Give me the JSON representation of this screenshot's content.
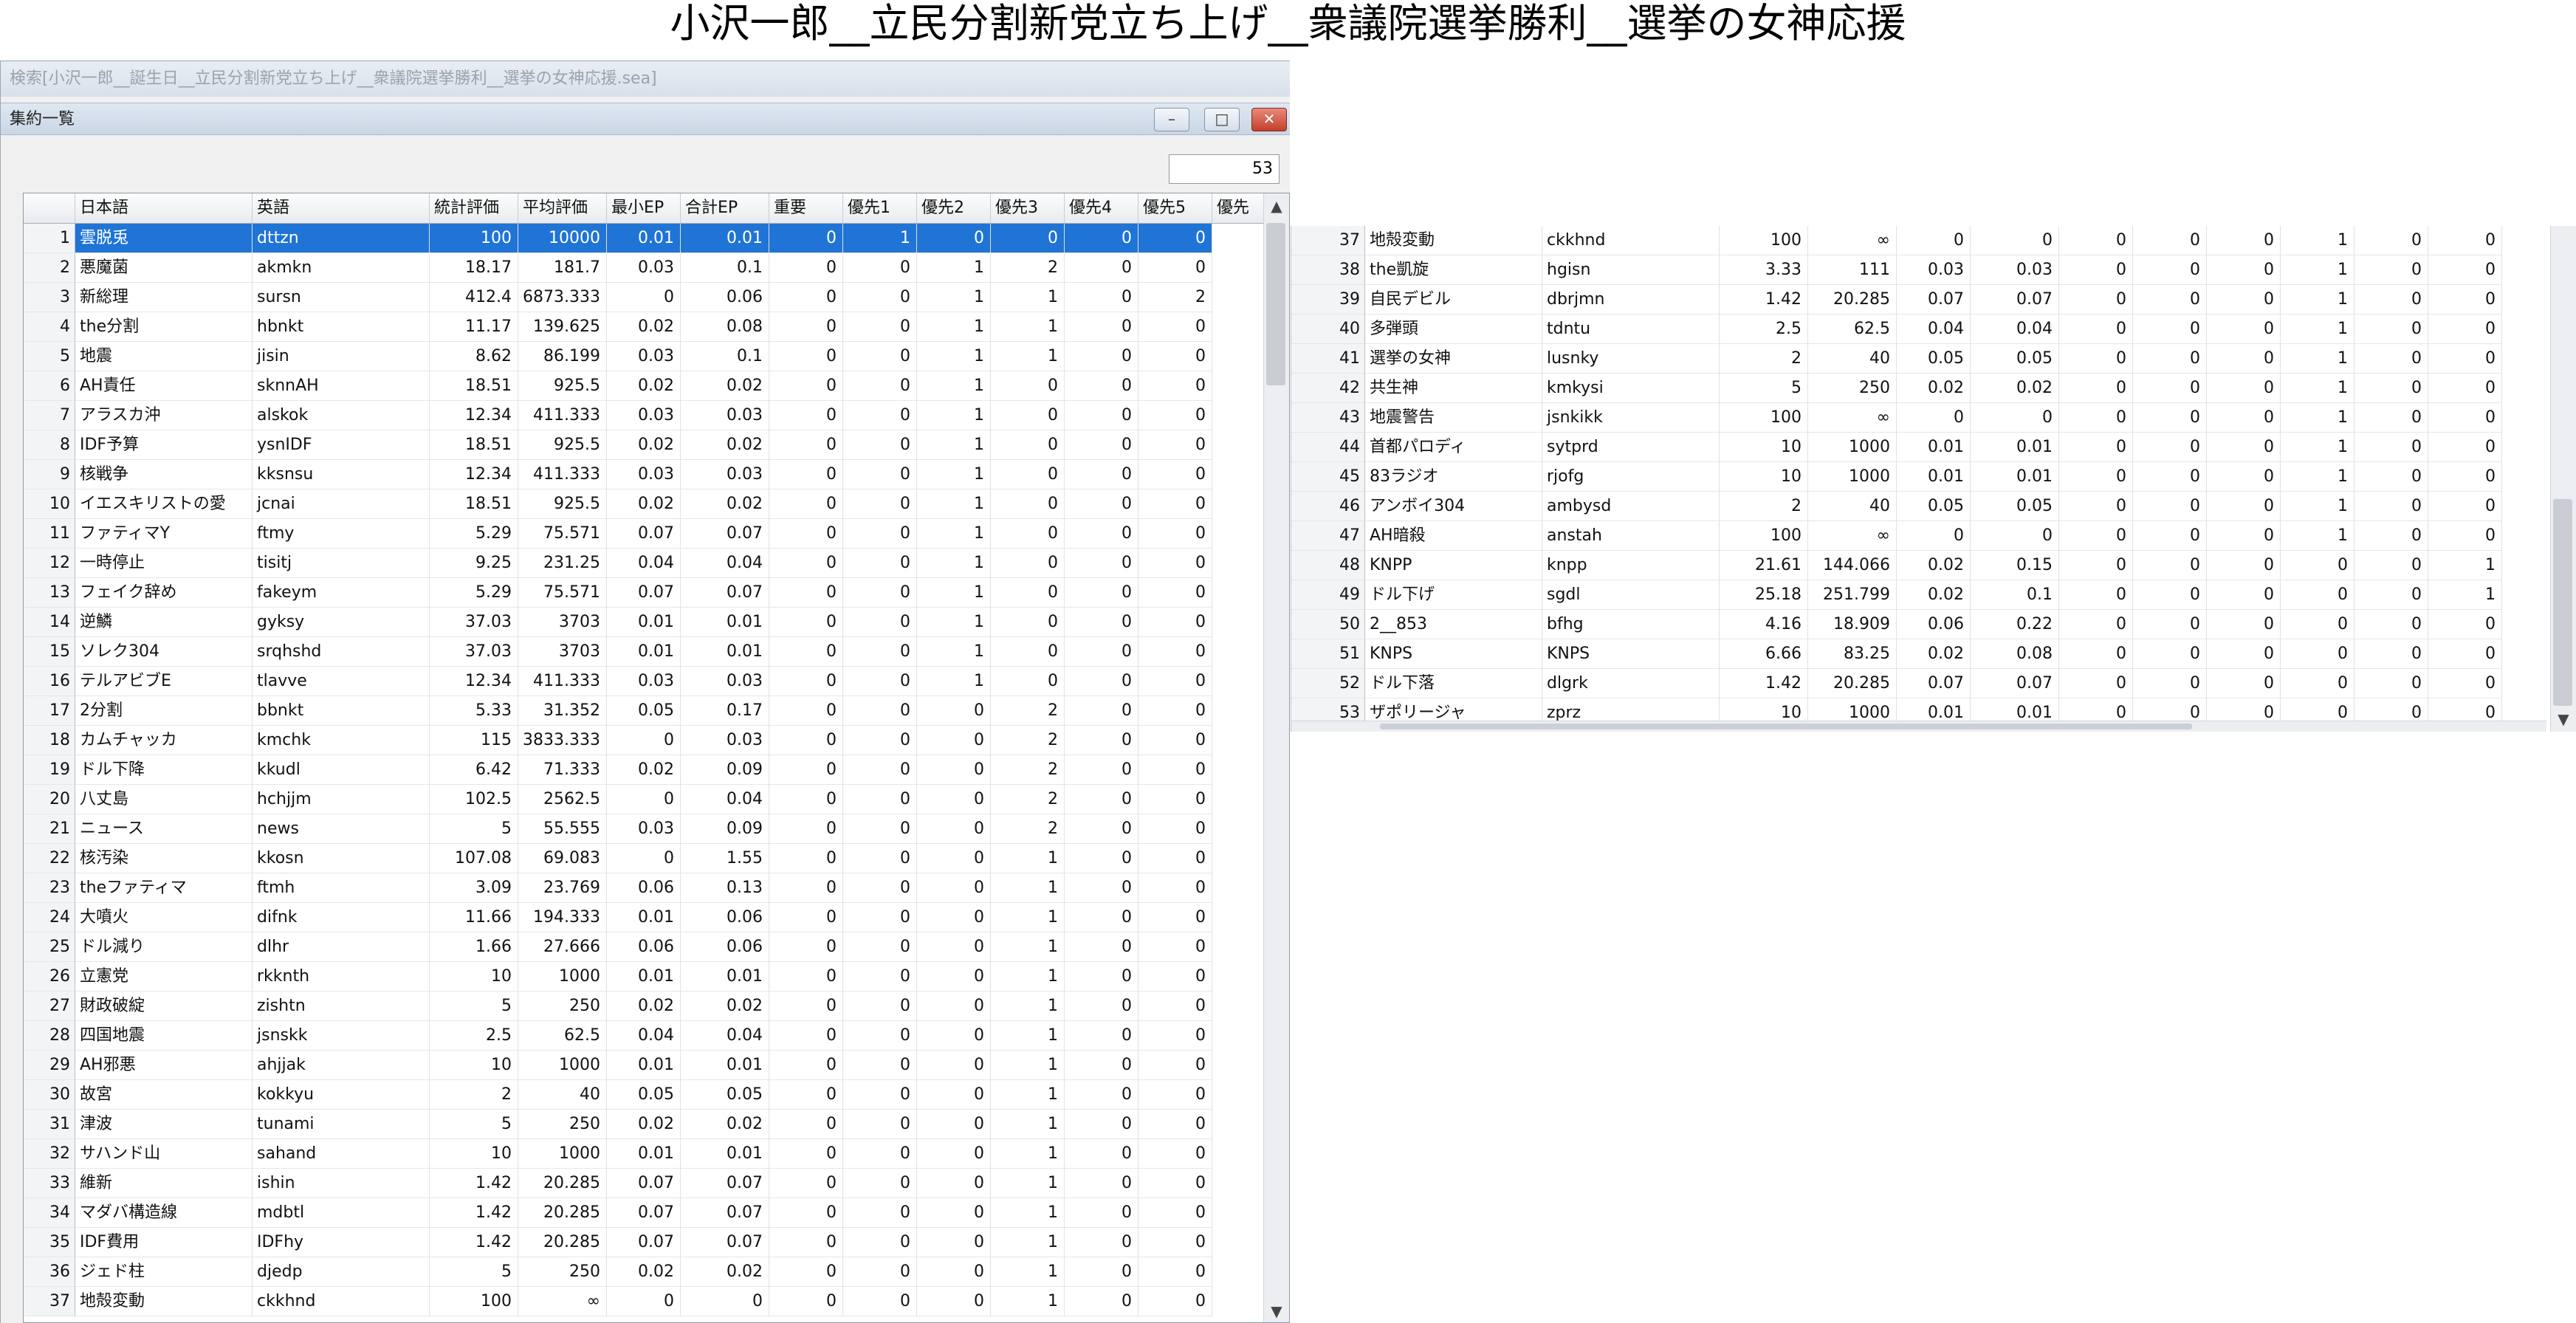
{
  "page_title": "小沢一郎__立民分割新党立ち上げ__衆議院選挙勝利__選挙の女神応援",
  "outer_window": {
    "title": "検索[小沢一郎__誕生日__立民分割新党立ち上げ__衆議院選挙勝利__選挙の女神応援.sea]"
  },
  "window": {
    "title": "集約一覧",
    "buttons": {
      "minimize": "–",
      "maximize": "□",
      "close": "✕"
    },
    "count": "53"
  },
  "columns": [
    "",
    "日本語",
    "英語",
    "統計評価",
    "平均評価",
    "最小EP",
    "合計EP",
    "重要",
    "優先1",
    "優先2",
    "優先3",
    "優先4",
    "優先5",
    "優先"
  ],
  "rows": [
    [
      "1",
      "雲脱兎",
      "dttzn",
      "100",
      "10000",
      "0.01",
      "0.01",
      "0",
      "1",
      "0",
      "0",
      "0",
      "0"
    ],
    [
      "2",
      "悪魔菌",
      "akmkn",
      "18.17",
      "181.7",
      "0.03",
      "0.1",
      "0",
      "0",
      "1",
      "2",
      "0",
      "0"
    ],
    [
      "3",
      "新総理",
      "sursn",
      "412.4",
      "6873.333",
      "0",
      "0.06",
      "0",
      "0",
      "1",
      "1",
      "0",
      "2"
    ],
    [
      "4",
      "the分割",
      "hbnkt",
      "11.17",
      "139.625",
      "0.02",
      "0.08",
      "0",
      "0",
      "1",
      "1",
      "0",
      "0"
    ],
    [
      "5",
      "地震",
      "jisin",
      "8.62",
      "86.199",
      "0.03",
      "0.1",
      "0",
      "0",
      "1",
      "1",
      "0",
      "0"
    ],
    [
      "6",
      "AH責任",
      "sknnAH",
      "18.51",
      "925.5",
      "0.02",
      "0.02",
      "0",
      "0",
      "1",
      "0",
      "0",
      "0"
    ],
    [
      "7",
      "アラスカ沖",
      "alskok",
      "12.34",
      "411.333",
      "0.03",
      "0.03",
      "0",
      "0",
      "1",
      "0",
      "0",
      "0"
    ],
    [
      "8",
      "IDF予算",
      "ysnIDF",
      "18.51",
      "925.5",
      "0.02",
      "0.02",
      "0",
      "0",
      "1",
      "0",
      "0",
      "0"
    ],
    [
      "9",
      "核戦争",
      "kksnsu",
      "12.34",
      "411.333",
      "0.03",
      "0.03",
      "0",
      "0",
      "1",
      "0",
      "0",
      "0"
    ],
    [
      "10",
      "イエスキリストの愛",
      "jcnai",
      "18.51",
      "925.5",
      "0.02",
      "0.02",
      "0",
      "0",
      "1",
      "0",
      "0",
      "0"
    ],
    [
      "11",
      "ファティマY",
      "ftmy",
      "5.29",
      "75.571",
      "0.07",
      "0.07",
      "0",
      "0",
      "1",
      "0",
      "0",
      "0"
    ],
    [
      "12",
      "一時停止",
      "tisitj",
      "9.25",
      "231.25",
      "0.04",
      "0.04",
      "0",
      "0",
      "1",
      "0",
      "0",
      "0"
    ],
    [
      "13",
      "フェイク辞め",
      "fakeym",
      "5.29",
      "75.571",
      "0.07",
      "0.07",
      "0",
      "0",
      "1",
      "0",
      "0",
      "0"
    ],
    [
      "14",
      "逆鱗",
      "gyksy",
      "37.03",
      "3703",
      "0.01",
      "0.01",
      "0",
      "0",
      "1",
      "0",
      "0",
      "0"
    ],
    [
      "15",
      "ソレク304",
      "srqhshd",
      "37.03",
      "3703",
      "0.01",
      "0.01",
      "0",
      "0",
      "1",
      "0",
      "0",
      "0"
    ],
    [
      "16",
      "テルアビブE",
      "tlavve",
      "12.34",
      "411.333",
      "0.03",
      "0.03",
      "0",
      "0",
      "1",
      "0",
      "0",
      "0"
    ],
    [
      "17",
      "2分割",
      "bbnkt",
      "5.33",
      "31.352",
      "0.05",
      "0.17",
      "0",
      "0",
      "0",
      "2",
      "0",
      "0"
    ],
    [
      "18",
      "カムチャッカ",
      "kmchk",
      "115",
      "3833.333",
      "0",
      "0.03",
      "0",
      "0",
      "0",
      "2",
      "0",
      "0"
    ],
    [
      "19",
      "ドル下降",
      "kkudl",
      "6.42",
      "71.333",
      "0.02",
      "0.09",
      "0",
      "0",
      "0",
      "2",
      "0",
      "0"
    ],
    [
      "20",
      "八丈島",
      "hchjjm",
      "102.5",
      "2562.5",
      "0",
      "0.04",
      "0",
      "0",
      "0",
      "2",
      "0",
      "0"
    ],
    [
      "21",
      "ニュース",
      "news",
      "5",
      "55.555",
      "0.03",
      "0.09",
      "0",
      "0",
      "0",
      "2",
      "0",
      "0"
    ],
    [
      "22",
      "核汚染",
      "kkosn",
      "107.08",
      "69.083",
      "0",
      "1.55",
      "0",
      "0",
      "0",
      "1",
      "0",
      "0"
    ],
    [
      "23",
      "theファティマ",
      "ftmh",
      "3.09",
      "23.769",
      "0.06",
      "0.13",
      "0",
      "0",
      "0",
      "1",
      "0",
      "0"
    ],
    [
      "24",
      "大噴火",
      "difnk",
      "11.66",
      "194.333",
      "0.01",
      "0.06",
      "0",
      "0",
      "0",
      "1",
      "0",
      "0"
    ],
    [
      "25",
      "ドル減り",
      "dlhr",
      "1.66",
      "27.666",
      "0.06",
      "0.06",
      "0",
      "0",
      "0",
      "1",
      "0",
      "0"
    ],
    [
      "26",
      "立憲党",
      "rkknth",
      "10",
      "1000",
      "0.01",
      "0.01",
      "0",
      "0",
      "0",
      "1",
      "0",
      "0"
    ],
    [
      "27",
      "財政破綻",
      "zishtn",
      "5",
      "250",
      "0.02",
      "0.02",
      "0",
      "0",
      "0",
      "1",
      "0",
      "0"
    ],
    [
      "28",
      "四国地震",
      "jsnskk",
      "2.5",
      "62.5",
      "0.04",
      "0.04",
      "0",
      "0",
      "0",
      "1",
      "0",
      "0"
    ],
    [
      "29",
      "AH邪悪",
      "ahjjak",
      "10",
      "1000",
      "0.01",
      "0.01",
      "0",
      "0",
      "0",
      "1",
      "0",
      "0"
    ],
    [
      "30",
      "故宮",
      "kokkyu",
      "2",
      "40",
      "0.05",
      "0.05",
      "0",
      "0",
      "0",
      "1",
      "0",
      "0"
    ],
    [
      "31",
      "津波",
      "tunami",
      "5",
      "250",
      "0.02",
      "0.02",
      "0",
      "0",
      "0",
      "1",
      "0",
      "0"
    ],
    [
      "32",
      "サハンド山",
      "sahand",
      "10",
      "1000",
      "0.01",
      "0.01",
      "0",
      "0",
      "0",
      "1",
      "0",
      "0"
    ],
    [
      "33",
      "維新",
      "ishin",
      "1.42",
      "20.285",
      "0.07",
      "0.07",
      "0",
      "0",
      "0",
      "1",
      "0",
      "0"
    ],
    [
      "34",
      "マダバ構造線",
      "mdbtl",
      "1.42",
      "20.285",
      "0.07",
      "0.07",
      "0",
      "0",
      "0",
      "1",
      "0",
      "0"
    ],
    [
      "35",
      "IDF費用",
      "IDFhy",
      "1.42",
      "20.285",
      "0.07",
      "0.07",
      "0",
      "0",
      "0",
      "1",
      "0",
      "0"
    ],
    [
      "36",
      "ジェド柱",
      "djedp",
      "5",
      "250",
      "0.02",
      "0.02",
      "0",
      "0",
      "0",
      "1",
      "0",
      "0"
    ],
    [
      "37",
      "地殻変動",
      "ckkhnd",
      "100",
      "∞",
      "0",
      "0",
      "0",
      "0",
      "0",
      "1",
      "0",
      "0"
    ]
  ],
  "rows2": [
    [
      "37",
      "地殻変動",
      "ckkhnd",
      "100",
      "∞",
      "0",
      "0",
      "0",
      "0",
      "0",
      "1",
      "0",
      "0"
    ],
    [
      "38",
      "the凱旋",
      "hgisn",
      "3.33",
      "111",
      "0.03",
      "0.03",
      "0",
      "0",
      "0",
      "1",
      "0",
      "0"
    ],
    [
      "39",
      "自民デビル",
      "dbrjmn",
      "1.42",
      "20.285",
      "0.07",
      "0.07",
      "0",
      "0",
      "0",
      "1",
      "0",
      "0"
    ],
    [
      "40",
      "多弾頭",
      "tdntu",
      "2.5",
      "62.5",
      "0.04",
      "0.04",
      "0",
      "0",
      "0",
      "1",
      "0",
      "0"
    ],
    [
      "41",
      "選挙の女神",
      "lusnky",
      "2",
      "40",
      "0.05",
      "0.05",
      "0",
      "0",
      "0",
      "1",
      "0",
      "0"
    ],
    [
      "42",
      "共生神",
      "kmkysi",
      "5",
      "250",
      "0.02",
      "0.02",
      "0",
      "0",
      "0",
      "1",
      "0",
      "0"
    ],
    [
      "43",
      "地震警告",
      "jsnkikk",
      "100",
      "∞",
      "0",
      "0",
      "0",
      "0",
      "0",
      "1",
      "0",
      "0"
    ],
    [
      "44",
      "首都パロディ",
      "sytprd",
      "10",
      "1000",
      "0.01",
      "0.01",
      "0",
      "0",
      "0",
      "1",
      "0",
      "0"
    ],
    [
      "45",
      "83ラジオ",
      "rjofg",
      "10",
      "1000",
      "0.01",
      "0.01",
      "0",
      "0",
      "0",
      "1",
      "0",
      "0"
    ],
    [
      "46",
      "アンボイ304",
      "ambysd",
      "2",
      "40",
      "0.05",
      "0.05",
      "0",
      "0",
      "0",
      "1",
      "0",
      "0"
    ],
    [
      "47",
      "AH暗殺",
      "anstah",
      "100",
      "∞",
      "0",
      "0",
      "0",
      "0",
      "0",
      "1",
      "0",
      "0"
    ],
    [
      "48",
      "KNPP",
      "knpp",
      "21.61",
      "144.066",
      "0.02",
      "0.15",
      "0",
      "0",
      "0",
      "0",
      "0",
      "1"
    ],
    [
      "49",
      "ドル下げ",
      "sgdl",
      "25.18",
      "251.799",
      "0.02",
      "0.1",
      "0",
      "0",
      "0",
      "0",
      "0",
      "1"
    ],
    [
      "50",
      "2__853",
      "bfhg",
      "4.16",
      "18.909",
      "0.06",
      "0.22",
      "0",
      "0",
      "0",
      "0",
      "0",
      "0"
    ],
    [
      "51",
      "KNPS",
      "KNPS",
      "6.66",
      "83.25",
      "0.02",
      "0.08",
      "0",
      "0",
      "0",
      "0",
      "0",
      "0"
    ],
    [
      "52",
      "ドル下落",
      "dlgrk",
      "1.42",
      "20.285",
      "0.07",
      "0.07",
      "0",
      "0",
      "0",
      "0",
      "0",
      "0"
    ],
    [
      "53",
      "ザポリージャ",
      "zprz",
      "10",
      "1000",
      "0.01",
      "0.01",
      "0",
      "0",
      "0",
      "0",
      "0",
      "0"
    ]
  ],
  "scroll": {
    "up": "▲",
    "down": "▼"
  }
}
